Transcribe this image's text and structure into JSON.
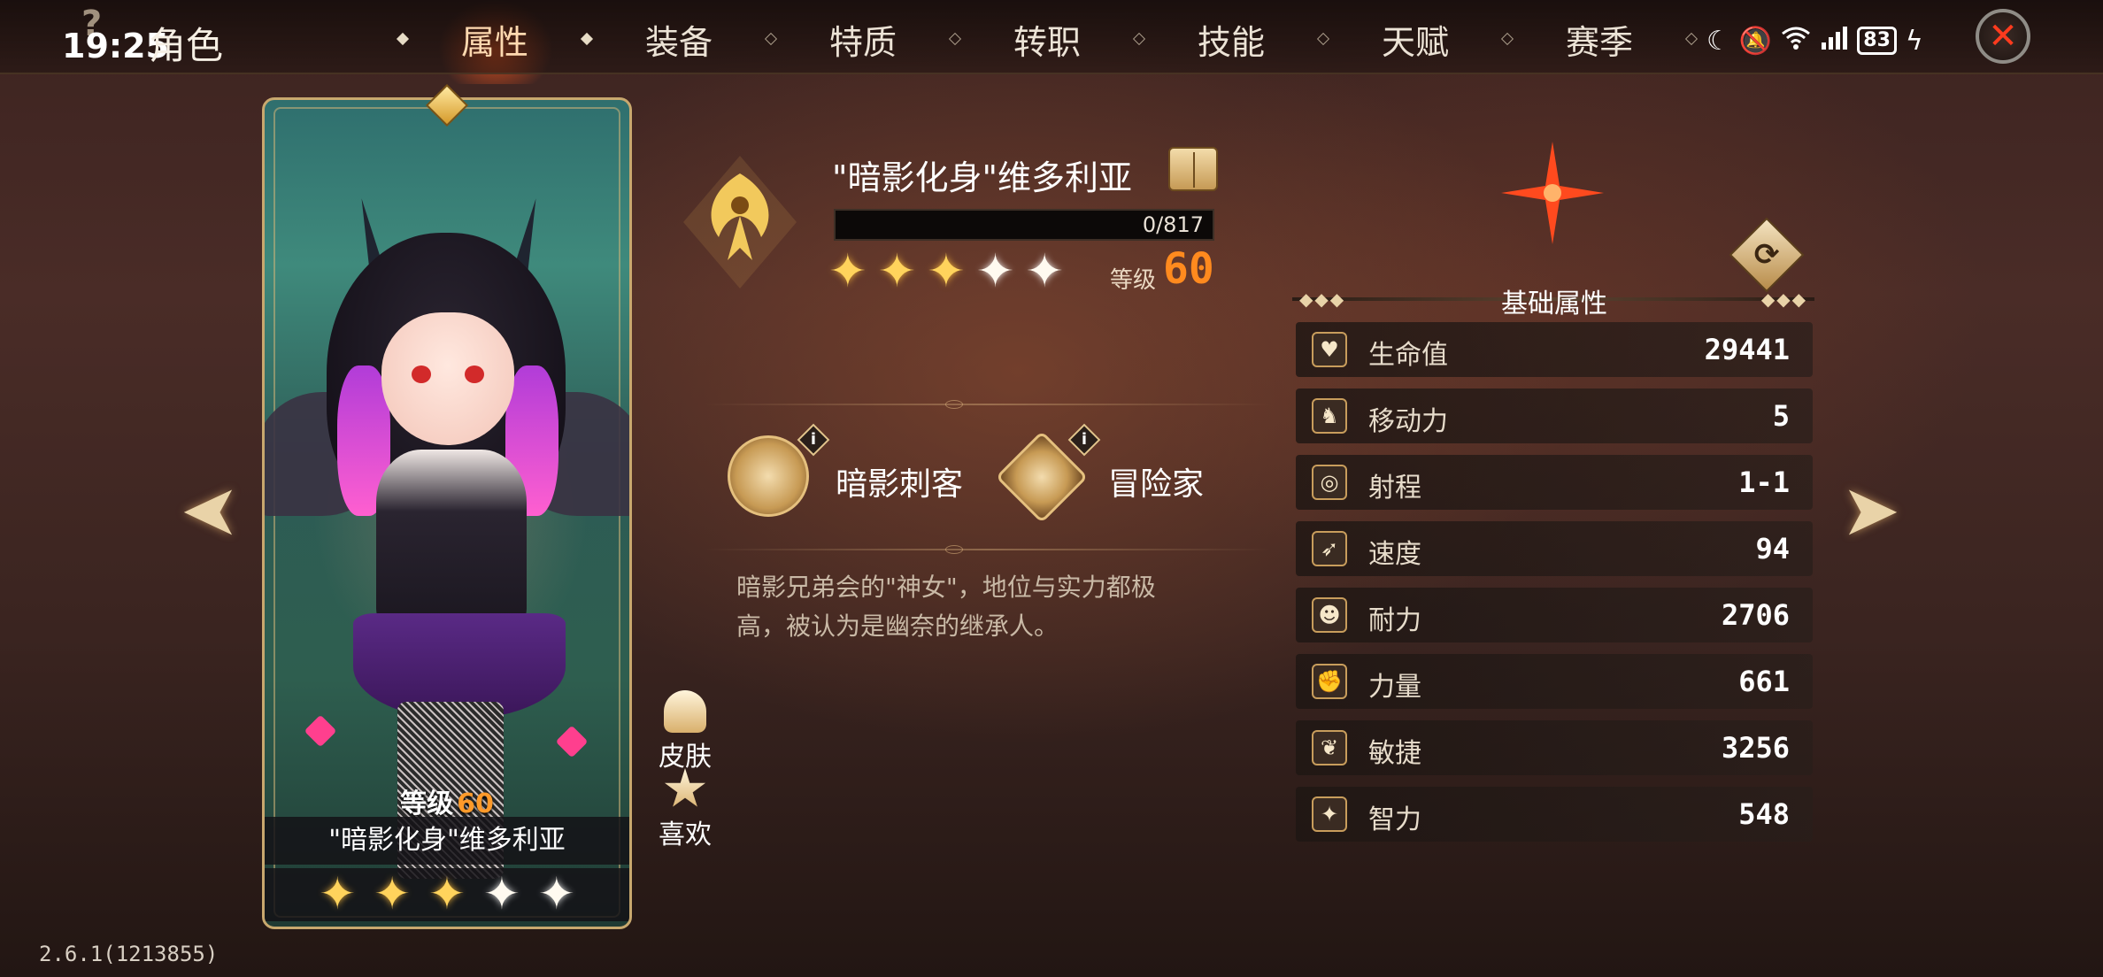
{
  "status_bar": {
    "time": "19:25",
    "battery": "83"
  },
  "header": {
    "title": "角色",
    "tabs": [
      {
        "label": "属性",
        "active": true
      },
      {
        "label": "装备"
      },
      {
        "label": "特质"
      },
      {
        "label": "转职"
      },
      {
        "label": "技能"
      },
      {
        "label": "天赋"
      },
      {
        "label": "赛季"
      }
    ]
  },
  "card": {
    "level_label": "等级",
    "level": "60",
    "name": "\"暗影化身\"维多利亚",
    "stars": 5
  },
  "side_buttons": {
    "skin": "皮肤",
    "favorite": "喜欢"
  },
  "hero": {
    "name": "\"暗影化身\"维多利亚",
    "xp": "0/817",
    "level_label": "等级",
    "level": "60",
    "classes": [
      {
        "label": "暗影刺客"
      },
      {
        "label": "冒险家"
      }
    ],
    "info_glyph": "i",
    "description": "暗影兄弟会的\"神女\"，地位与实力都极高，被认为是幽奈的继承人。"
  },
  "stats": {
    "title": "基础属性",
    "rows": [
      {
        "name": "生命值",
        "value": "29441",
        "icon": "heart-icon"
      },
      {
        "name": "移动力",
        "value": "5",
        "icon": "boot-icon"
      },
      {
        "name": "射程",
        "value": "1-1",
        "icon": "target-icon"
      },
      {
        "name": "速度",
        "value": "94",
        "icon": "wing-icon"
      },
      {
        "name": "耐力",
        "value": "2706",
        "icon": "person-icon"
      },
      {
        "name": "力量",
        "value": "661",
        "icon": "arm-icon"
      },
      {
        "name": "敏捷",
        "value": "3256",
        "icon": "leaf-icon"
      },
      {
        "name": "智力",
        "value": "548",
        "icon": "sparkle-icon"
      }
    ]
  },
  "version": "2.6.1(1213855)",
  "colors": {
    "accent": "#ff8a1e",
    "close": "#ff3b1e",
    "gold": "#c89d5c"
  }
}
